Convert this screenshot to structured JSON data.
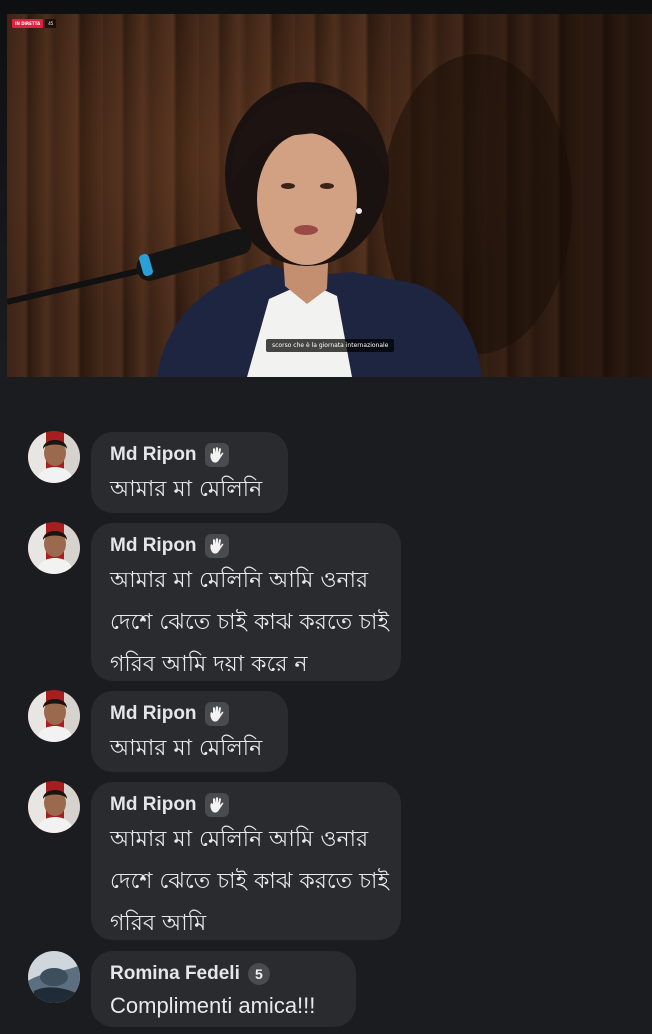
{
  "video": {
    "live_label": "IN DIRETTA",
    "viewer_count": "45",
    "subtitle": "scorso che è la giornata internazionale"
  },
  "comments": [
    {
      "author": "Md Ripon",
      "badge": "wave-hand-icon",
      "lines": [
        "আমার মা মেলিনি"
      ]
    },
    {
      "author": "Md Ripon",
      "badge": "wave-hand-icon",
      "lines": [
        "আমার মা মেলিনি আমি ওনার",
        "দেশে ঝেতে চাই কাঝ করতে চাই",
        "গরিব আমি দয়া করে ন"
      ]
    },
    {
      "author": "Md Ripon",
      "badge": "wave-hand-icon",
      "lines": [
        "আমার মা মেলিনি"
      ]
    },
    {
      "author": "Md Ripon",
      "badge": "wave-hand-icon",
      "lines": [
        "আমার মা মেলিনি আমি ওনার",
        "দেশে ঝেতে চাই কাঝ করতে চাই",
        "গরিব আমি"
      ]
    },
    {
      "author": "Romina Fedeli",
      "badge": "level-5-badge-icon",
      "badge_text": "5",
      "lines": [
        "Complimenti amica!!!"
      ]
    }
  ],
  "colors": {
    "background": "#1b1c20",
    "bubble": "#2a2b2e",
    "live": "#e41e3f",
    "text": "#e8e9ec"
  }
}
